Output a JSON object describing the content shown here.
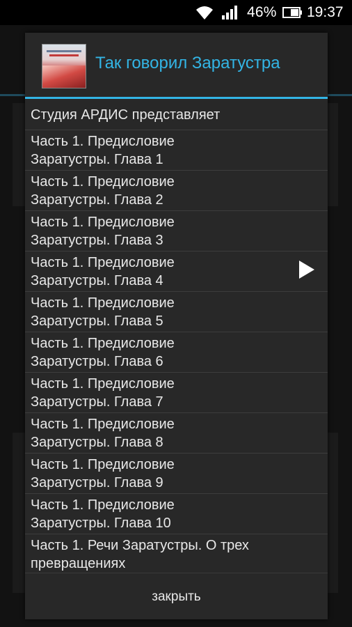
{
  "status_bar": {
    "battery_percent": "46%",
    "time": "19:37",
    "icons": [
      "wifi-icon",
      "signal-icon",
      "battery-icon"
    ]
  },
  "dialog": {
    "title": "Так говорил Заратустра",
    "accent_color": "#33b5e5",
    "cover_icon": "book-cover-image",
    "items": [
      {
        "label": "Студия АРДИС представляет"
      },
      {
        "label": "Часть 1. Предисловие Заратустры. Глава 1"
      },
      {
        "label": "Часть 1. Предисловие Заратустры. Глава 2"
      },
      {
        "label": "Часть 1. Предисловие Заратустры. Глава 3"
      },
      {
        "label": "Часть 1. Предисловие Заратустры. Глава 4",
        "playing": true
      },
      {
        "label": "Часть 1. Предисловие Заратустры. Глава 5"
      },
      {
        "label": "Часть 1. Предисловие Заратустры. Глава 6"
      },
      {
        "label": "Часть 1. Предисловие Заратустры. Глава 7"
      },
      {
        "label": "Часть 1. Предисловие Заратустры. Глава 8"
      },
      {
        "label": "Часть 1. Предисловие Заратустры. Глава 9"
      },
      {
        "label": "Часть 1. Предисловие Заратустры. Глава 10"
      },
      {
        "label": "Часть 1. Речи Заратустры. О трех превращениях"
      }
    ],
    "close_label": "закрыть"
  }
}
